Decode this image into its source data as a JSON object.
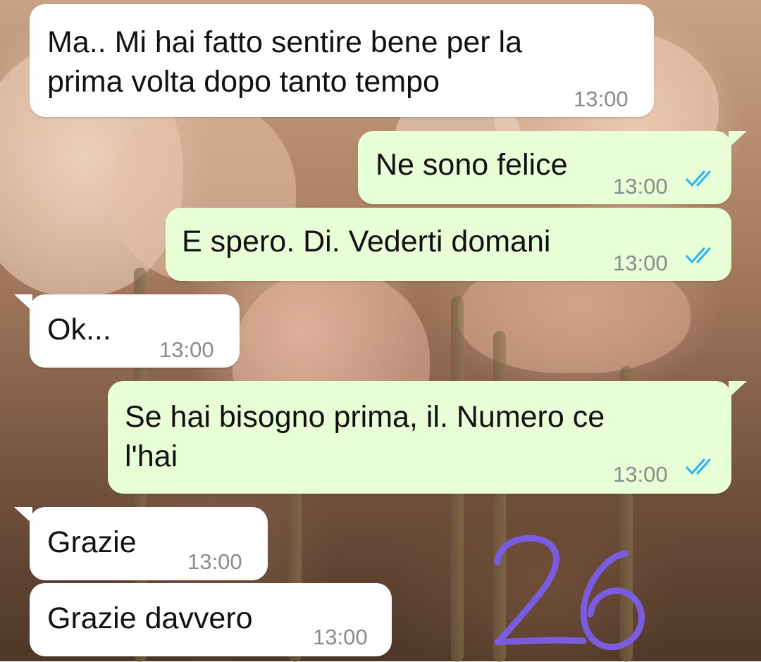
{
  "messages": [
    {
      "direction": "incoming",
      "text": "Ma.. Mi hai fatto sentire bene per la\nprima volta dopo tanto tempo",
      "time": "13:00"
    },
    {
      "direction": "outgoing",
      "text": "Ne sono felice",
      "time": "13:00",
      "status": "read"
    },
    {
      "direction": "outgoing",
      "text": "E spero. Di. Vederti domani",
      "time": "13:00",
      "status": "read"
    },
    {
      "direction": "incoming",
      "text": "Ok...",
      "time": "13:00"
    },
    {
      "direction": "outgoing",
      "text": "Se hai bisogno prima, il. Numero ce\nl'hai",
      "time": "13:00",
      "status": "read"
    },
    {
      "direction": "incoming",
      "text": "Grazie",
      "time": "13:00"
    },
    {
      "direction": "incoming",
      "text": "Grazie davvero",
      "time": "13:00"
    }
  ],
  "overlay": {
    "handwritten_number": "26"
  },
  "colors": {
    "incoming_bubble": "#ffffff",
    "outgoing_bubble": "#e7fed6",
    "read_ticks": "#34b7f1",
    "time_text": "#8b8b8b",
    "handwriting": "#7b5ce0"
  },
  "icons": {
    "read_status": "double-check-icon"
  }
}
